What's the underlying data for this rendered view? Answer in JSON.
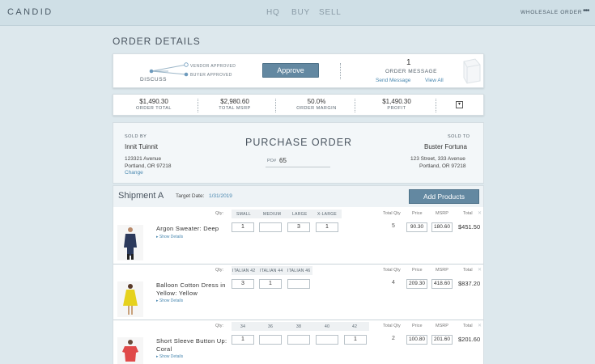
{
  "nav": {
    "logo": "CANDID",
    "links": [
      "HQ",
      "BUY",
      "SELL"
    ],
    "wholesale": "WHOLESALE ORDER",
    "more": "•••"
  },
  "page": {
    "title": "ORDER DETAILS"
  },
  "approval": {
    "discuss": "DISCUSS",
    "vendor_approved": "VENDOR APPROVED",
    "buyer_approved": "BUYER APPROVED",
    "approve_label": "Approve",
    "message_count": "1",
    "message_label": "ORDER MESSAGE",
    "send_message": "Send Message",
    "view_all": "View All"
  },
  "stats": [
    {
      "value": "$1,490.30",
      "label": "ORDER TOTAL"
    },
    {
      "value": "$2,980.60",
      "label": "TOTAL MSRP"
    },
    {
      "value": "50.0%",
      "label": "ORDER MARGIN"
    },
    {
      "value": "$1,490.30",
      "label": "PROFIT"
    }
  ],
  "po": {
    "sold_by_label": "SOLD BY",
    "sold_by_name": "Innit Tuinnit",
    "sold_by_addr1": "123321 Avenue",
    "sold_by_addr2": "Portland, OR 97218",
    "change": "Change",
    "title": "PURCHASE ORDER",
    "po_label": "PO#",
    "po_number": "65",
    "sold_to_label": "SOLD TO",
    "sold_to_name": "Buster Fortuna",
    "sold_to_addr1": "123 Street, 333 Avenue",
    "sold_to_addr2": "Portland, OR 97218"
  },
  "shipment": {
    "title": "Shipment A",
    "target_label": "Target Date:",
    "target_date": "1/31/2019",
    "add_products": "Add Products",
    "qty_label": "Qty:",
    "col_total_qty": "Total Qty",
    "col_price": "Price",
    "col_msrp": "MSRP",
    "col_total": "Total",
    "show_details": "Show Details",
    "colors": {
      "accent": "#6388a1",
      "link": "#4a88b0"
    },
    "items": [
      {
        "name_line1": "Argon Sweater: Deep",
        "name_line2": "",
        "sizes": [
          "SMALL",
          "MEDIUM",
          "LARGE",
          "X-LARGE"
        ],
        "qty": [
          "1",
          "",
          "3",
          "1"
        ],
        "total_qty": "5",
        "price": "90.30",
        "msrp": "180.60",
        "total": "$451.50"
      },
      {
        "name_line1": "Balloon Cotton Dress in",
        "name_line2": "Yellow: Yellow",
        "sizes": [
          "ITALIAN 42",
          "ITALIAN 44",
          "ITALIAN 46"
        ],
        "qty": [
          "3",
          "1",
          ""
        ],
        "total_qty": "4",
        "price": "209.30",
        "msrp": "418.60",
        "total": "$837.20"
      },
      {
        "name_line1": "Short Sleeve Button Up:",
        "name_line2": "Coral",
        "sizes": [
          "34",
          "36",
          "38",
          "40",
          "42"
        ],
        "qty": [
          "1",
          "",
          "",
          "",
          "1"
        ],
        "total_qty": "2",
        "price": "100.80",
        "msrp": "201.60",
        "total": "$201.60"
      }
    ]
  }
}
